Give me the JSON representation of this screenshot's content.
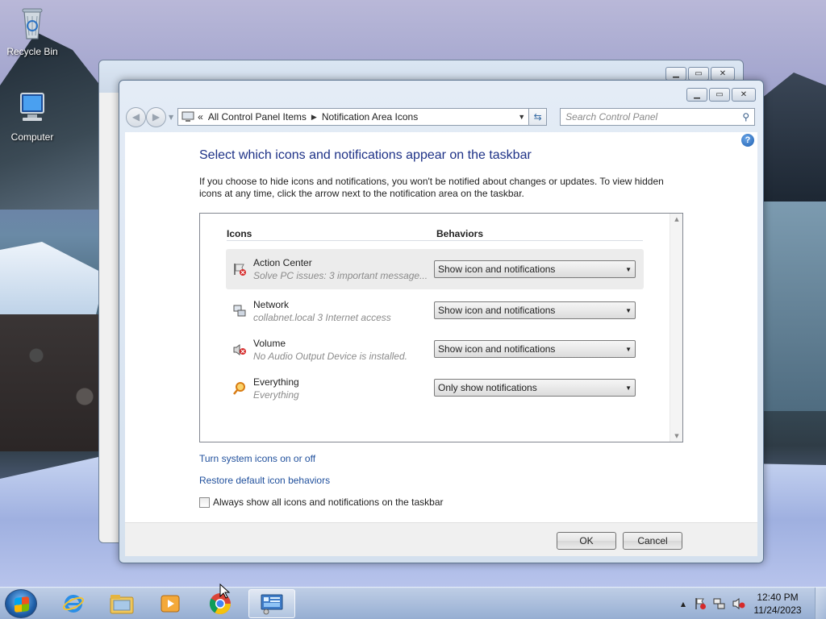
{
  "desktop": {
    "icons": [
      {
        "label": "Recycle Bin",
        "icon": "recycle-bin-icon"
      },
      {
        "label": "Computer",
        "icon": "computer-icon"
      }
    ]
  },
  "window": {
    "nav": {
      "breadcrumb": [
        "All Control Panel Items",
        "Notification Area Icons"
      ],
      "breadcrumb_prefix": "«",
      "search_placeholder": "Search Control Panel"
    },
    "heading": "Select which icons and notifications appear on the taskbar",
    "description": "If you choose to hide icons and notifications, you won't be notified about changes or updates. To view hidden icons at any time, click the arrow next to the notification area on the taskbar.",
    "columns": {
      "icons": "Icons",
      "behaviors": "Behaviors"
    },
    "rows": [
      {
        "name": "Action Center",
        "sub": "Solve PC issues: 3 important message...",
        "behavior": "Show icon and notifications",
        "icon": "action-center-flag-icon",
        "selected": true
      },
      {
        "name": "Network",
        "sub": "collabnet.local  3 Internet access",
        "behavior": "Show icon and notifications",
        "icon": "network-icon",
        "selected": false
      },
      {
        "name": "Volume",
        "sub": "No Audio Output Device is installed.",
        "behavior": "Show icon and notifications",
        "icon": "volume-muted-icon",
        "selected": false
      },
      {
        "name": "Everything",
        "sub": "Everything",
        "behavior": "Only show notifications",
        "icon": "everything-search-icon",
        "selected": false
      }
    ],
    "links": {
      "system_icons": "Turn system icons on or off",
      "restore": "Restore default icon behaviors"
    },
    "checkbox_label": "Always show all icons and notifications on the taskbar",
    "checkbox_checked": false,
    "buttons": {
      "ok": "OK",
      "cancel": "Cancel"
    }
  },
  "taskbar": {
    "items": [
      "start",
      "internet-explorer",
      "windows-explorer",
      "media-player",
      "chrome",
      "control-panel"
    ],
    "active_item": "control-panel",
    "clock_time": "12:40 PM",
    "clock_date": "11/24/2023"
  },
  "colors": {
    "heading": "#1e3287",
    "link": "#1f4f9c"
  }
}
